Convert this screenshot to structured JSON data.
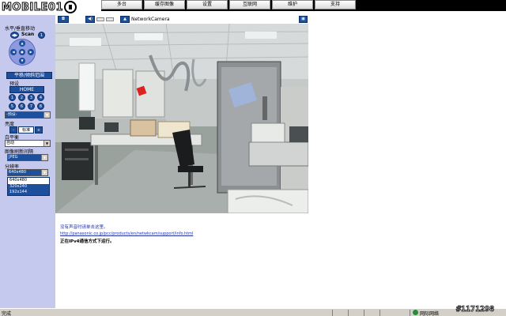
{
  "logo": {
    "text": "MOBILE01"
  },
  "menu": {
    "tabs": [
      "多台",
      "缓存图像",
      "设置",
      "互联网",
      "维护",
      "支持"
    ]
  },
  "sidebar": {
    "pan_tilt_label": "水平/垂直移动",
    "scan_label": "Scan",
    "range_button": "平移/倾斜范围",
    "preset_label": "预设",
    "home_button": "HOME",
    "preset_numbers": [
      "1",
      "2",
      "3",
      "4",
      "5",
      "6",
      "7",
      "8"
    ],
    "preset_select": "-预设-",
    "brightness_label": "亮度",
    "brightness_minus": "-",
    "brightness_std": "标准",
    "brightness_plus": "+",
    "white_balance_label": "白平衡",
    "white_balance_value": "自动",
    "format_label": "图像刷新间隔",
    "format_value": "JPEG",
    "resolution_label": "分辨率",
    "resolution_value": "640x480",
    "resolution_options": [
      "640x480",
      "320x240",
      "192x144"
    ]
  },
  "camera": {
    "title": "NetworkCamera"
  },
  "notes": {
    "audio": "没有声音时请单击这里。",
    "link": "http://panasonic.co.jp/pcc/products/en/netwkcam/support/info.html",
    "ipv4": "正在IPv4通信方式下运行。"
  },
  "statusbar": {
    "status": "完成",
    "zone": "网际网络"
  },
  "watermark": "#1171298",
  "colors": {
    "sidebar_bg": "#c6c9ee",
    "accent_blue": "#1c4f9c",
    "menu_bg": "#000000",
    "link": "#2233aa"
  }
}
